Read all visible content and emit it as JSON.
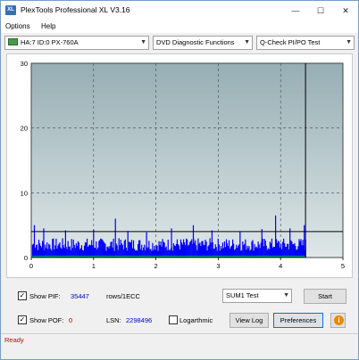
{
  "window": {
    "title": "PlexTools Professional XL V3.16",
    "icon_label": "XL",
    "controls": [
      "minimize",
      "maximize",
      "close"
    ]
  },
  "menu": {
    "items": [
      "Options",
      "Help"
    ]
  },
  "toolbar": {
    "drive": "HA:7 ID:0  PX-760A",
    "function": "DVD Diagnostic Functions",
    "test": "Q-Check PI/PO Test"
  },
  "chart_data": {
    "type": "bar",
    "xlim": [
      0,
      5
    ],
    "ylim": [
      0,
      30
    ],
    "x_ticks": [
      "0",
      "1",
      "2",
      "3",
      "4",
      "5"
    ],
    "y_ticks": [
      "0",
      "10",
      "20",
      "30"
    ],
    "grid": true,
    "data_end_x": 4.4,
    "threshold_y": 4,
    "series": [
      {
        "color": "#0000ff",
        "typical_range": [
          1,
          3
        ],
        "peaks": [
          [
            0.05,
            5
          ],
          [
            0.2,
            4.5
          ],
          [
            0.55,
            4.2
          ],
          [
            1.0,
            4.3
          ],
          [
            1.35,
            6
          ],
          [
            1.55,
            4.1
          ],
          [
            1.85,
            3.9
          ],
          [
            2.25,
            4.5
          ],
          [
            2.6,
            5
          ],
          [
            2.9,
            4.2
          ],
          [
            3.35,
            4
          ],
          [
            3.7,
            4.4
          ],
          [
            3.92,
            6.5
          ],
          [
            4.15,
            4.5
          ],
          [
            4.38,
            5
          ]
        ]
      },
      {
        "color": "#00cc00",
        "typical_range": [
          0,
          0.3
        ]
      }
    ],
    "colors": {
      "background_top": "#96aeb4",
      "background_bottom": "#dfe7e8",
      "grid": "#3c4a4e",
      "threshold": "#000000",
      "end_marker": "#000000"
    }
  },
  "controls": {
    "show_pif_label": "Show PIF:",
    "show_pif_checked": true,
    "pif_value": "35447",
    "rows_label": "rows/1ECC",
    "show_pof_label": "Show POF:",
    "show_pof_checked": true,
    "pof_value": "0",
    "lsn_label": "LSN:",
    "lsn_value": "2298496",
    "logarithmic_label": "Logarthmic",
    "logarithmic_checked": false,
    "sum_select": "SUM1 Test",
    "start_button": "Start",
    "view_log_button": "View Log",
    "preferences_button": "Preferences",
    "info_icon": "info-icon"
  },
  "status": {
    "text": "Ready"
  }
}
